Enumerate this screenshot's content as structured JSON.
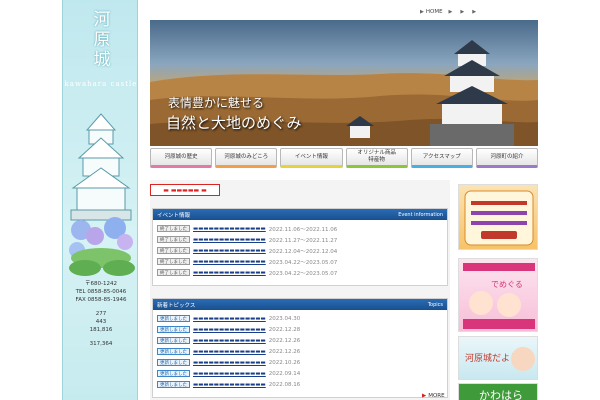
{
  "sidebar": {
    "title": "河原城",
    "subtitle": "鳥取県河原町",
    "en_name": "kawahara castle",
    "info_lines": [
      "〒680-1242",
      "TEL 0858-85-0046",
      "FAX 0858-85-1946"
    ],
    "stats": [
      "277",
      "443",
      "181,816",
      "317,364"
    ]
  },
  "topnav": {
    "links": [
      "HOME",
      "",
      "",
      ""
    ]
  },
  "hero": {
    "line1": "表情豊かに魅せる",
    "line2": "自然と大地のめぐみ"
  },
  "tabs": [
    "河原城の歴史",
    "河原城のみどころ",
    "イベント情報",
    "オリジナル商品\n特産物",
    "アクセスマップ",
    "河原町の紹介"
  ],
  "events": {
    "heading": "イベント情報",
    "heading_en": "Event information",
    "items": [
      {
        "badge": "終了しました",
        "date": "2022.11.06〜2022.11.06"
      },
      {
        "badge": "終了しました",
        "date": "2022.11.27〜2022.11.27"
      },
      {
        "badge": "終了しました",
        "date": "2022.12.04〜2022.12.04"
      },
      {
        "badge": "終了しました",
        "date": "2023.04.22〜2023.05.07"
      },
      {
        "badge": "終了しました",
        "date": "2023.04.22〜2023.05.07"
      }
    ]
  },
  "topics": {
    "heading": "新着トピックス",
    "heading_en": "Topics",
    "items": [
      {
        "badge": "更新しました",
        "date": "2023.04.30"
      },
      {
        "badge": "更新しました",
        "date": "2022.12.28"
      },
      {
        "badge": "更新しました",
        "date": "2022.12.26"
      },
      {
        "badge": "更新しました",
        "date": "2022.12.26"
      },
      {
        "badge": "更新しました",
        "date": "2022.10.26"
      },
      {
        "badge": "更新しました",
        "date": "2022.09.14"
      },
      {
        "badge": "更新しました",
        "date": "2022.08.16"
      }
    ]
  },
  "more_label": "MORE",
  "banners": {
    "b2_text": "でめぐる",
    "b3_text": "河原城だより",
    "b4_text": "かわはら"
  },
  "colors": {
    "sidebar": "#c6ebef",
    "panel_header": "#1a4f8e",
    "notice_red": "#dd2222"
  }
}
